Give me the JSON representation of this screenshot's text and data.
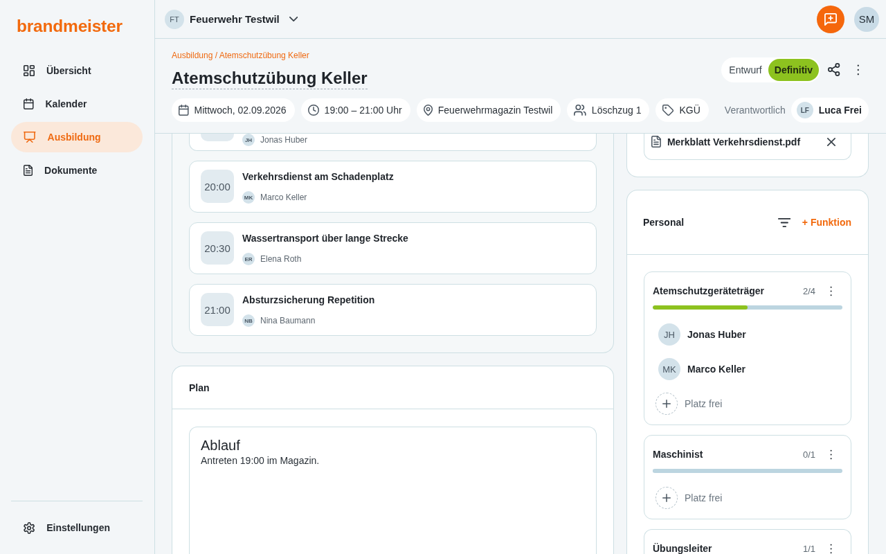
{
  "sidebar": {
    "logo": "brandmeister",
    "items": [
      {
        "label": "Übersicht",
        "selected": false
      },
      {
        "label": "Kalender",
        "selected": false
      },
      {
        "label": "Ausbildung",
        "selected": true
      },
      {
        "label": "Dokumente",
        "selected": false
      }
    ],
    "footer_items": [
      {
        "label": "Einstellungen"
      }
    ]
  },
  "topbar": {
    "organization": {
      "initials": "FT",
      "name": "Feuerwehr Testwil"
    },
    "user": {
      "initials": "SM"
    }
  },
  "header": {
    "breadcrumb": "Ausbildung / Atemschutzübung Keller",
    "title": "Atemschutzübung Keller",
    "status_options": [
      {
        "label": "Entwurf",
        "selected": false
      },
      {
        "label": "Definitiv",
        "selected": true
      }
    ],
    "chips": [
      {
        "label": "Mittwoch, 02.09.2026"
      },
      {
        "label": "19:00 – 21:00 Uhr"
      },
      {
        "label": "Feuerwehrmagazin Testwil"
      },
      {
        "label": "Löschzug 1"
      },
      {
        "label": "KGÜ"
      }
    ],
    "responsible": {
      "label": "Verantwortlich",
      "initials": "LF",
      "name": "Luca Frei"
    }
  },
  "schedule": {
    "items": [
      {
        "initials": "JH",
        "person": "Jonas Huber"
      },
      {
        "time": "20:00",
        "title": "Verkehrsdienst am Schadenplatz",
        "initials": "MK",
        "person": "Marco Keller"
      },
      {
        "time": "20:30",
        "title": "Wassertransport über lange Strecke",
        "initials": "ER",
        "person": "Elena Roth"
      },
      {
        "time": "21:00",
        "title": "Absturzsicherung Repetition",
        "initials": "NB",
        "person": "Nina Baumann"
      }
    ]
  },
  "plan": {
    "title": "Plan",
    "heading": "Ablauf",
    "text": "Antreten 19:00 im Magazin."
  },
  "attachments": {
    "files": [
      {
        "name": "Merkblatt Verkehrsdienst.pdf"
      }
    ]
  },
  "personnel": {
    "title": "Personal",
    "add_label": "+ Funktion",
    "functions": [
      {
        "name": "Atemschutzgeräteträger",
        "count": "2/4",
        "level": 0.5,
        "members": [
          {
            "initials": "JH",
            "name": "Jonas Huber"
          },
          {
            "initials": "MK",
            "name": "Marco Keller"
          }
        ],
        "open_slots": [
          "Platz frei"
        ]
      },
      {
        "name": "Maschinist",
        "count": "0/1",
        "level": 0,
        "open_slots": [
          "Platz frei"
        ]
      },
      {
        "name": "Übungsleiter",
        "count": "1/1"
      }
    ]
  }
}
